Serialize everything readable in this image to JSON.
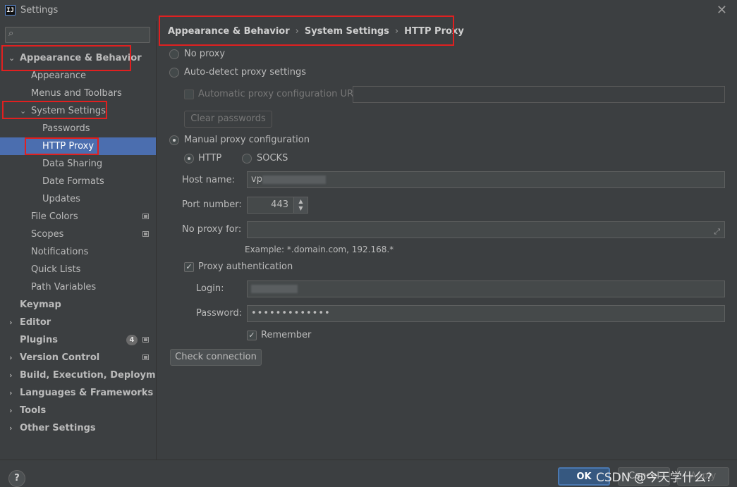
{
  "window": {
    "title": "Settings",
    "app_icon": "IJ"
  },
  "search": {
    "placeholder": ""
  },
  "sidebar": {
    "items": [
      {
        "label": "Appearance & Behavior"
      },
      {
        "label": "Appearance"
      },
      {
        "label": "Menus and Toolbars"
      },
      {
        "label": "System Settings"
      },
      {
        "label": "Passwords"
      },
      {
        "label": "HTTP Proxy"
      },
      {
        "label": "Data Sharing"
      },
      {
        "label": "Date Formats"
      },
      {
        "label": "Updates"
      },
      {
        "label": "File Colors"
      },
      {
        "label": "Scopes"
      },
      {
        "label": "Notifications"
      },
      {
        "label": "Quick Lists"
      },
      {
        "label": "Path Variables"
      },
      {
        "label": "Keymap"
      },
      {
        "label": "Editor"
      },
      {
        "label": "Plugins",
        "badge": "4"
      },
      {
        "label": "Version Control"
      },
      {
        "label": "Build, Execution, Deployment"
      },
      {
        "label": "Languages & Frameworks"
      },
      {
        "label": "Tools"
      },
      {
        "label": "Other Settings"
      }
    ]
  },
  "breadcrumb": {
    "parts": [
      "Appearance & Behavior",
      "System Settings",
      "HTTP Proxy"
    ],
    "sep": "›"
  },
  "proxy": {
    "no_proxy": "No proxy",
    "auto_detect": "Auto-detect proxy settings",
    "auto_url_label": "Automatic proxy configuration URL:",
    "auto_url_value": "",
    "clear_passwords": "Clear passwords",
    "manual": "Manual proxy configuration",
    "http": "HTTP",
    "socks": "SOCKS",
    "host_label": "Host name:",
    "host_value": "vp",
    "port_label": "Port number:",
    "port_value": "443",
    "no_proxy_for_label": "No proxy for:",
    "no_proxy_for_value": "",
    "example": "Example: *.domain.com, 192.168.*",
    "proxy_auth": "Proxy authentication",
    "login_label": "Login:",
    "login_value": "",
    "password_label": "Password:",
    "password_value": "•••••••••••••",
    "remember": "Remember",
    "check_connection": "Check connection"
  },
  "footer": {
    "help": "?",
    "ok": "OK",
    "cancel": "Cancel",
    "apply": "Apply"
  },
  "watermark": "CSDN @今天学什么?",
  "colors": {
    "selection": "#4b6eaf",
    "annotation": "#e02020",
    "ok_button": "#365880"
  }
}
